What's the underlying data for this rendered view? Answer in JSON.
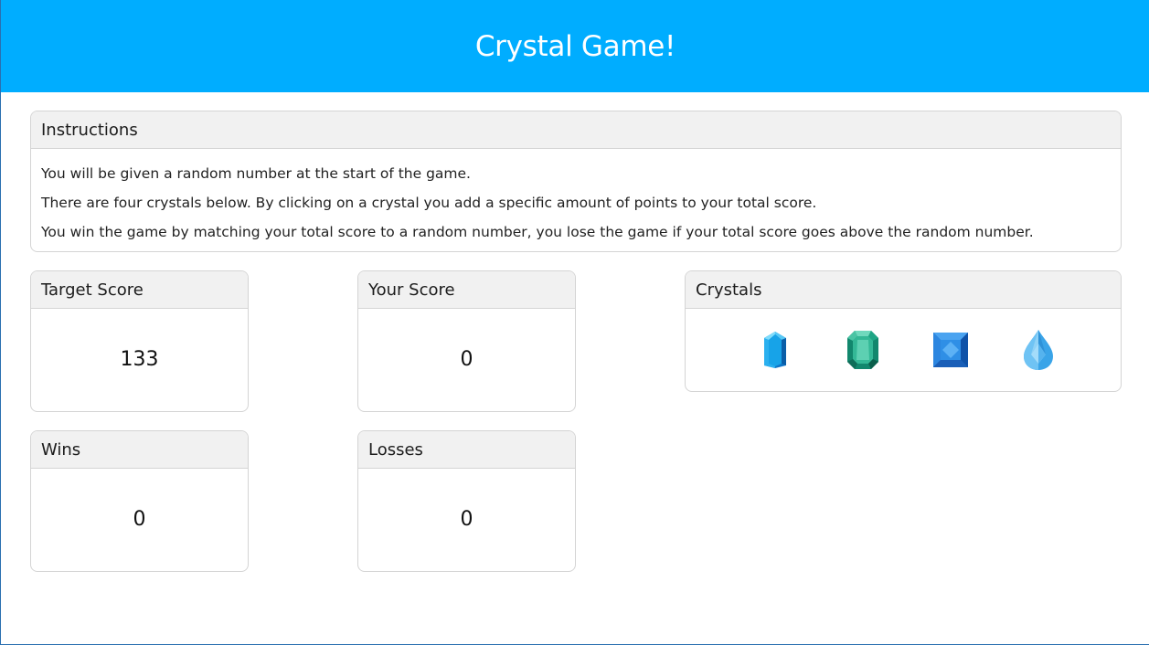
{
  "header": {
    "title": "Crystal Game!"
  },
  "instructions": {
    "title": "Instructions",
    "lines": [
      "You will be given a random number at the start of the game.",
      "There are four crystals below. By clicking on a crystal you add a specific amount of points to your total score.",
      "You win the game by matching your total score to a random number, you lose the game if your total score goes above the random number."
    ]
  },
  "target_score": {
    "title": "Target Score",
    "value": "133"
  },
  "your_score": {
    "title": "Your Score",
    "value": "0"
  },
  "wins": {
    "title": "Wins",
    "value": "0"
  },
  "losses": {
    "title": "Losses",
    "value": "0"
  },
  "crystals": {
    "title": "Crystals",
    "items": [
      "blue-crystal-icon",
      "green-emerald-icon",
      "blue-square-gem-icon",
      "blue-drop-gem-icon"
    ]
  },
  "colors": {
    "header_bg": "#00adff",
    "card_header_bg": "#f1f1f1"
  }
}
